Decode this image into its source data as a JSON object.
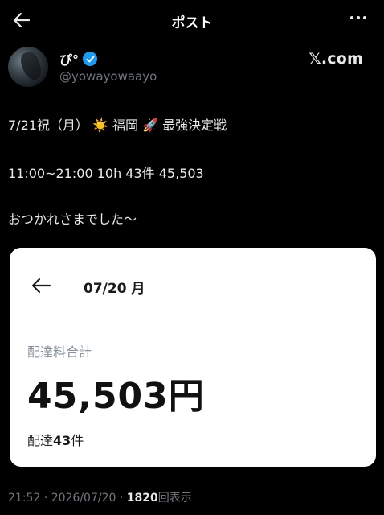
{
  "header": {
    "title": "ポスト"
  },
  "author": {
    "display_name": "ぴ°",
    "handle": "@yowayowaayo",
    "source": "𝕏.com"
  },
  "post": {
    "line1": "7/21祝（月） ☀️ 福岡 🚀 最強決定戦",
    "line2": "11:00~21:00 10h 43件 45,503",
    "line3": "おつかれさまでした〜"
  },
  "card": {
    "date": "07/20 月",
    "fee_label": "配達料合計",
    "fee_amount": "45,503円",
    "count_prefix": "配達",
    "count_value": "43",
    "count_suffix": "件"
  },
  "meta": {
    "timestamp": "21:52 · 2026/07/20 · ",
    "views": "1820",
    "views_suffix": "回表示"
  }
}
